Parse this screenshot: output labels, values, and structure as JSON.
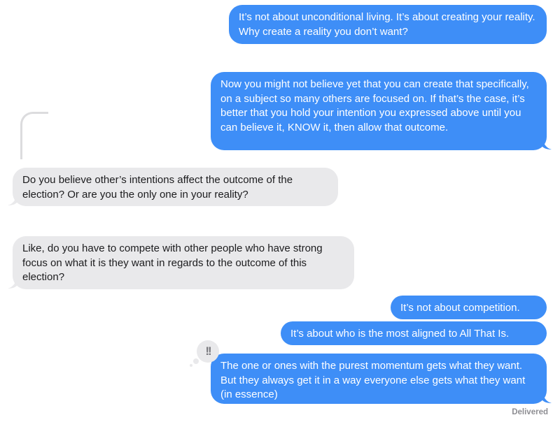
{
  "messages": [
    {
      "direction": "outgoing",
      "text": "It’s not about unconditional living. It’s about creating your reality. Why create a reality you don’t want?"
    },
    {
      "direction": "outgoing",
      "text": "Now you might not believe yet that you can create that specifically, on a subject so many others are focused on. If that’s the case, it’s better that you hold your intention you expressed above until you can believe it, KNOW it, then allow that outcome."
    },
    {
      "direction": "incoming",
      "text": "Do you believe other’s intentions affect the outcome of the election? Or are you the only one in your reality?"
    },
    {
      "direction": "incoming",
      "text": "Like, do you have to compete with other people who have strong focus on what it is they want in regards to the outcome of this election?"
    },
    {
      "direction": "outgoing",
      "text": "It’s not about competition."
    },
    {
      "direction": "outgoing",
      "text": "It’s about who is the most aligned to All That Is."
    },
    {
      "direction": "outgoing",
      "text": "The one or ones with the purest momentum gets what they want. But they always get it in a way everyone else gets what they want (in essence)"
    }
  ],
  "tapback": {
    "icon": "double-exclamation-icon",
    "glyph": "!!"
  },
  "status": {
    "delivered": "Delivered"
  },
  "colors": {
    "outgoing_bubble": "#3e8ef7",
    "incoming_bubble": "#e9e9eb",
    "status_text": "#8e8e93"
  }
}
